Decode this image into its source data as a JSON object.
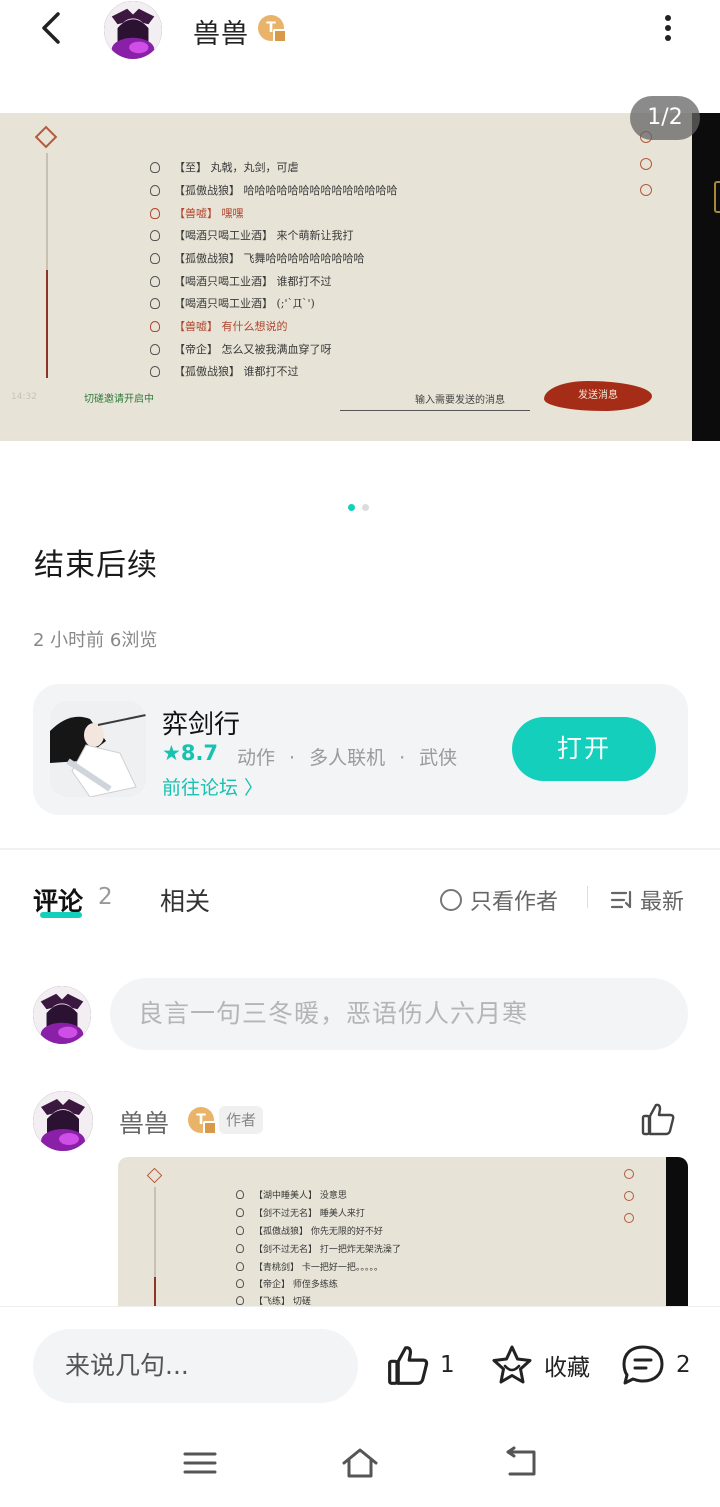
{
  "header": {
    "username": "兽兽",
    "level_badge": "T"
  },
  "carousel": {
    "counter": "1/2",
    "chat_lines": [
      {
        "text": "【至】 丸戟，丸剑，可虐",
        "highlight": false
      },
      {
        "text": "【孤傲战狼】 哈哈哈哈哈哈哈哈哈哈哈哈哈哈",
        "highlight": false
      },
      {
        "text": "【兽嘘】 嘿嘿",
        "highlight": true
      },
      {
        "text": "【喝酒只喝工业酒】 来个萌新让我打",
        "highlight": false
      },
      {
        "text": "【孤傲战狼】 飞舞哈哈哈哈哈哈哈哈哈",
        "highlight": false
      },
      {
        "text": "【喝酒只喝工业酒】 谁都打不过",
        "highlight": false
      },
      {
        "text": "【喝酒只喝工业酒】 (;'`Д`')",
        "highlight": false
      },
      {
        "text": "【兽嘘】 有什么想说的",
        "highlight": true
      },
      {
        "text": "【帝企】 怎么又被我满血穿了呀",
        "highlight": false
      },
      {
        "text": "【孤傲战狼】 谁都打不过",
        "highlight": false
      }
    ],
    "invite_text": "切磋邀请开启中",
    "input_placeholder": "输入需要发送的消息",
    "send_label": "发送消息",
    "time_text": "14:32"
  },
  "post": {
    "title": "结束后续",
    "meta": "2 小时前  6浏览"
  },
  "game": {
    "name": "弈剑行",
    "rating": "★8.7",
    "tags": [
      "动作",
      "多人联机",
      "武侠"
    ],
    "forum_link": "前往论坛 〉",
    "open_label": "打开"
  },
  "comments_section": {
    "tab_comments": "评论",
    "tab_count": "2",
    "tab_related": "相关",
    "author_only": "只看作者",
    "sort_label": "最新",
    "input_placeholder": "良言一句三冬暖，恶语伤人六月寒"
  },
  "comment": {
    "username": "兽兽",
    "level_badge": "T",
    "author_tag": "作者",
    "image_lines": [
      "【湖中睡美人】 没意思",
      "【剑不过无名】 睡美人来打",
      "【孤傲战狼】 你先无限的好不好",
      "【剑不过无名】 打一把炸无架洗澡了",
      "【青桃剑】 卡一把好一把。。。。。",
      "【帝企】 师侄多练练",
      "【飞练】 切磋"
    ]
  },
  "bottom_bar": {
    "reply_placeholder": "来说几句...",
    "like_count": "1",
    "favorite_label": "收藏",
    "comment_count": "2"
  },
  "colors": {
    "accent": "#15cfbd",
    "highlight_red": "#b0452f",
    "card_bg": "#f3f4f6"
  }
}
